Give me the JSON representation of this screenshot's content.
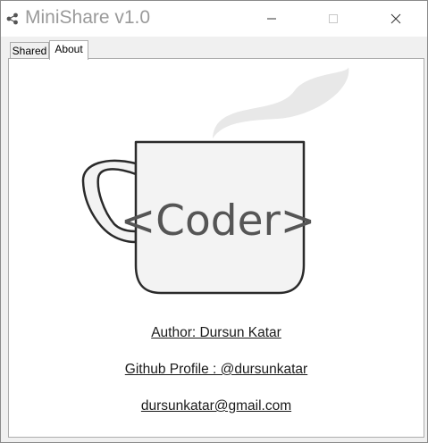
{
  "window": {
    "title": "MiniShare v1.0",
    "controls": {
      "minimize": "minimize-icon",
      "maximize": "maximize-icon",
      "close": "close-icon"
    }
  },
  "tabs": [
    {
      "label": "Shared",
      "selected": false
    },
    {
      "label": "About",
      "selected": true
    }
  ],
  "about": {
    "logo_text": "<Coder>",
    "author_link": "Author: Dursun Katar",
    "github_link": "Github Profile : @dursunkatar",
    "email_link": "dursunkatar@gmail.com"
  },
  "colors": {
    "title_text": "#9a9a9a",
    "logo_text": "#555555",
    "mug_fill": "#f3f3f3",
    "mug_outline": "#2a2a2a",
    "steam": "#e8e8e8"
  }
}
